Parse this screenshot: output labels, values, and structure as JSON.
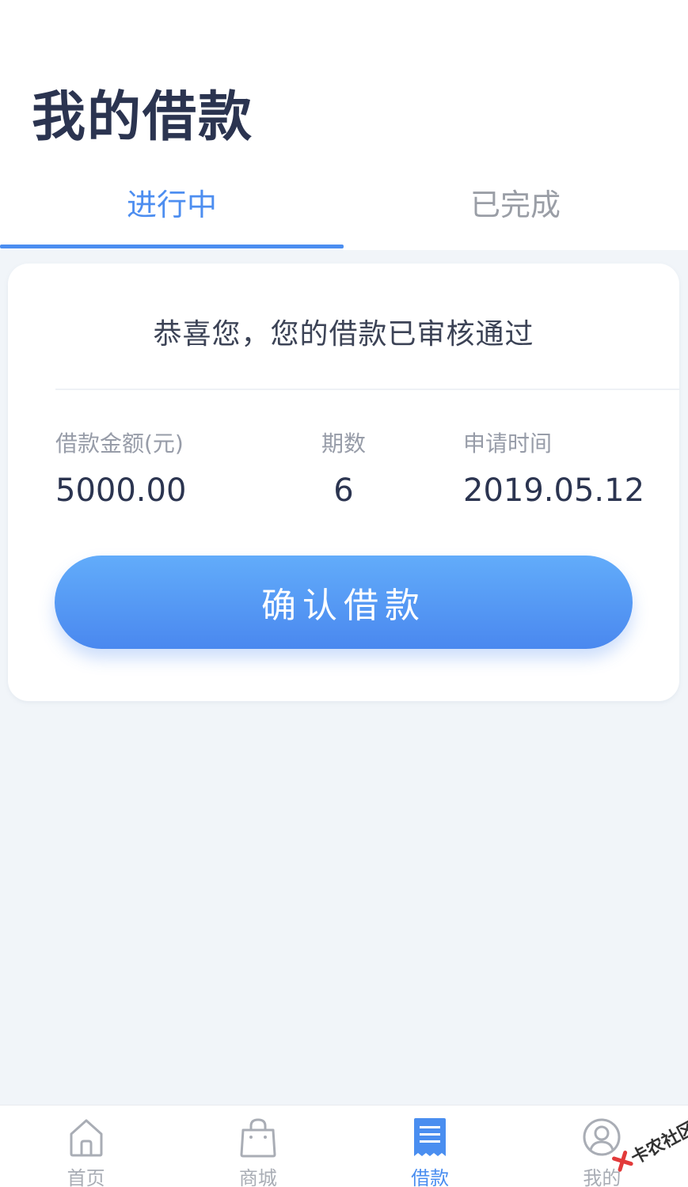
{
  "header": {
    "title": "我的借款",
    "tabs": [
      {
        "label": "进行中",
        "active": true
      },
      {
        "label": "已完成",
        "active": false
      }
    ]
  },
  "card": {
    "status_text": "恭喜您，您的借款已审核通过",
    "info": {
      "amount_label": "借款金额(元)",
      "amount_value": "5000.00",
      "periods_label": "期数",
      "periods_value": "6",
      "date_label": "申请时间",
      "date_value": "2019.05.12"
    },
    "confirm_button": "确认借款"
  },
  "tabbar": {
    "items": [
      {
        "label": "首页",
        "icon": "home-icon",
        "active": false
      },
      {
        "label": "商城",
        "icon": "shopping-bag-icon",
        "active": false
      },
      {
        "label": "借款",
        "icon": "document-icon",
        "active": true
      },
      {
        "label": "我的",
        "icon": "user-icon",
        "active": false
      }
    ]
  },
  "watermark": {
    "text": "卡农社区"
  },
  "colors": {
    "accent": "#4a8ef0",
    "title": "#2b3450",
    "background": "#f1f5f9",
    "inactive": "#a9adb5"
  }
}
